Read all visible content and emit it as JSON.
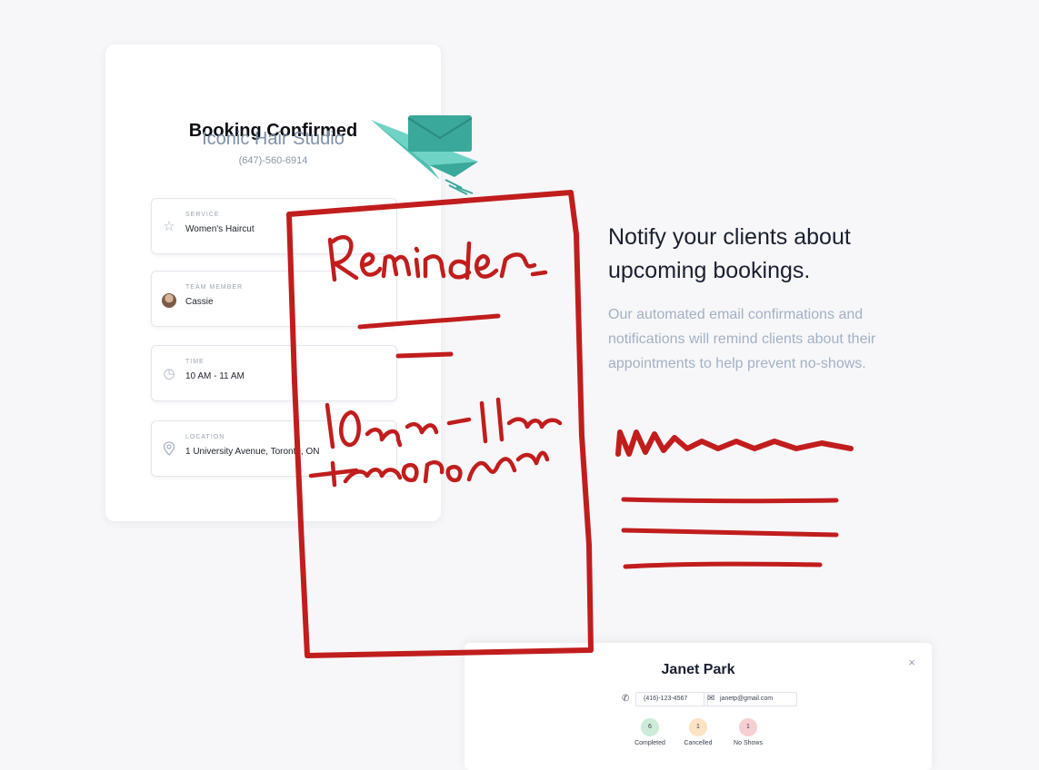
{
  "booking": {
    "title": "Booking Confirmed",
    "studio_name": "Iconic Hair Studio",
    "studio_phone": "(647)-560-6914",
    "details": [
      {
        "label": "SERVICE",
        "value": "Women's Haircut",
        "icon": "star-icon"
      },
      {
        "label": "TEAM MEMBER",
        "value": "Cassie",
        "icon": "avatar"
      },
      {
        "label": "TIME",
        "value": "10 AM - 11 AM",
        "icon": "clock-icon"
      },
      {
        "label": "LOCATION",
        "value": "1 University Avenue, Toronto, ON",
        "icon": "location-pin-icon"
      }
    ]
  },
  "marketing": {
    "headline_line1": "Notify your clients about",
    "headline_line2": "upcoming bookings.",
    "blurb_line1": "Our automated email confirmations and",
    "blurb_line2": "notifications will remind clients about their",
    "blurb_line3": "appointments to help prevent no-shows."
  },
  "client": {
    "name": "Janet Park",
    "phone": "(416)-123-4567",
    "email": "janetp@gmail.com",
    "close_label": "×",
    "stats": [
      {
        "value": "6",
        "label": "Completed",
        "color": "#cdebd8"
      },
      {
        "value": "1",
        "label": "Cancelled",
        "color": "#fbe3c4"
      },
      {
        "value": "1",
        "label": "No Shows",
        "color": "#f6cfd2"
      }
    ]
  },
  "annotation": {
    "ink_color": "#c11d1d",
    "handwritten_title": "Reminder",
    "handwritten_time": "10 am - 11 am",
    "handwritten_day": "tomorrow"
  },
  "colors": {
    "envelope": "#3aa89a",
    "paper_plane": "#6fd3c6"
  }
}
